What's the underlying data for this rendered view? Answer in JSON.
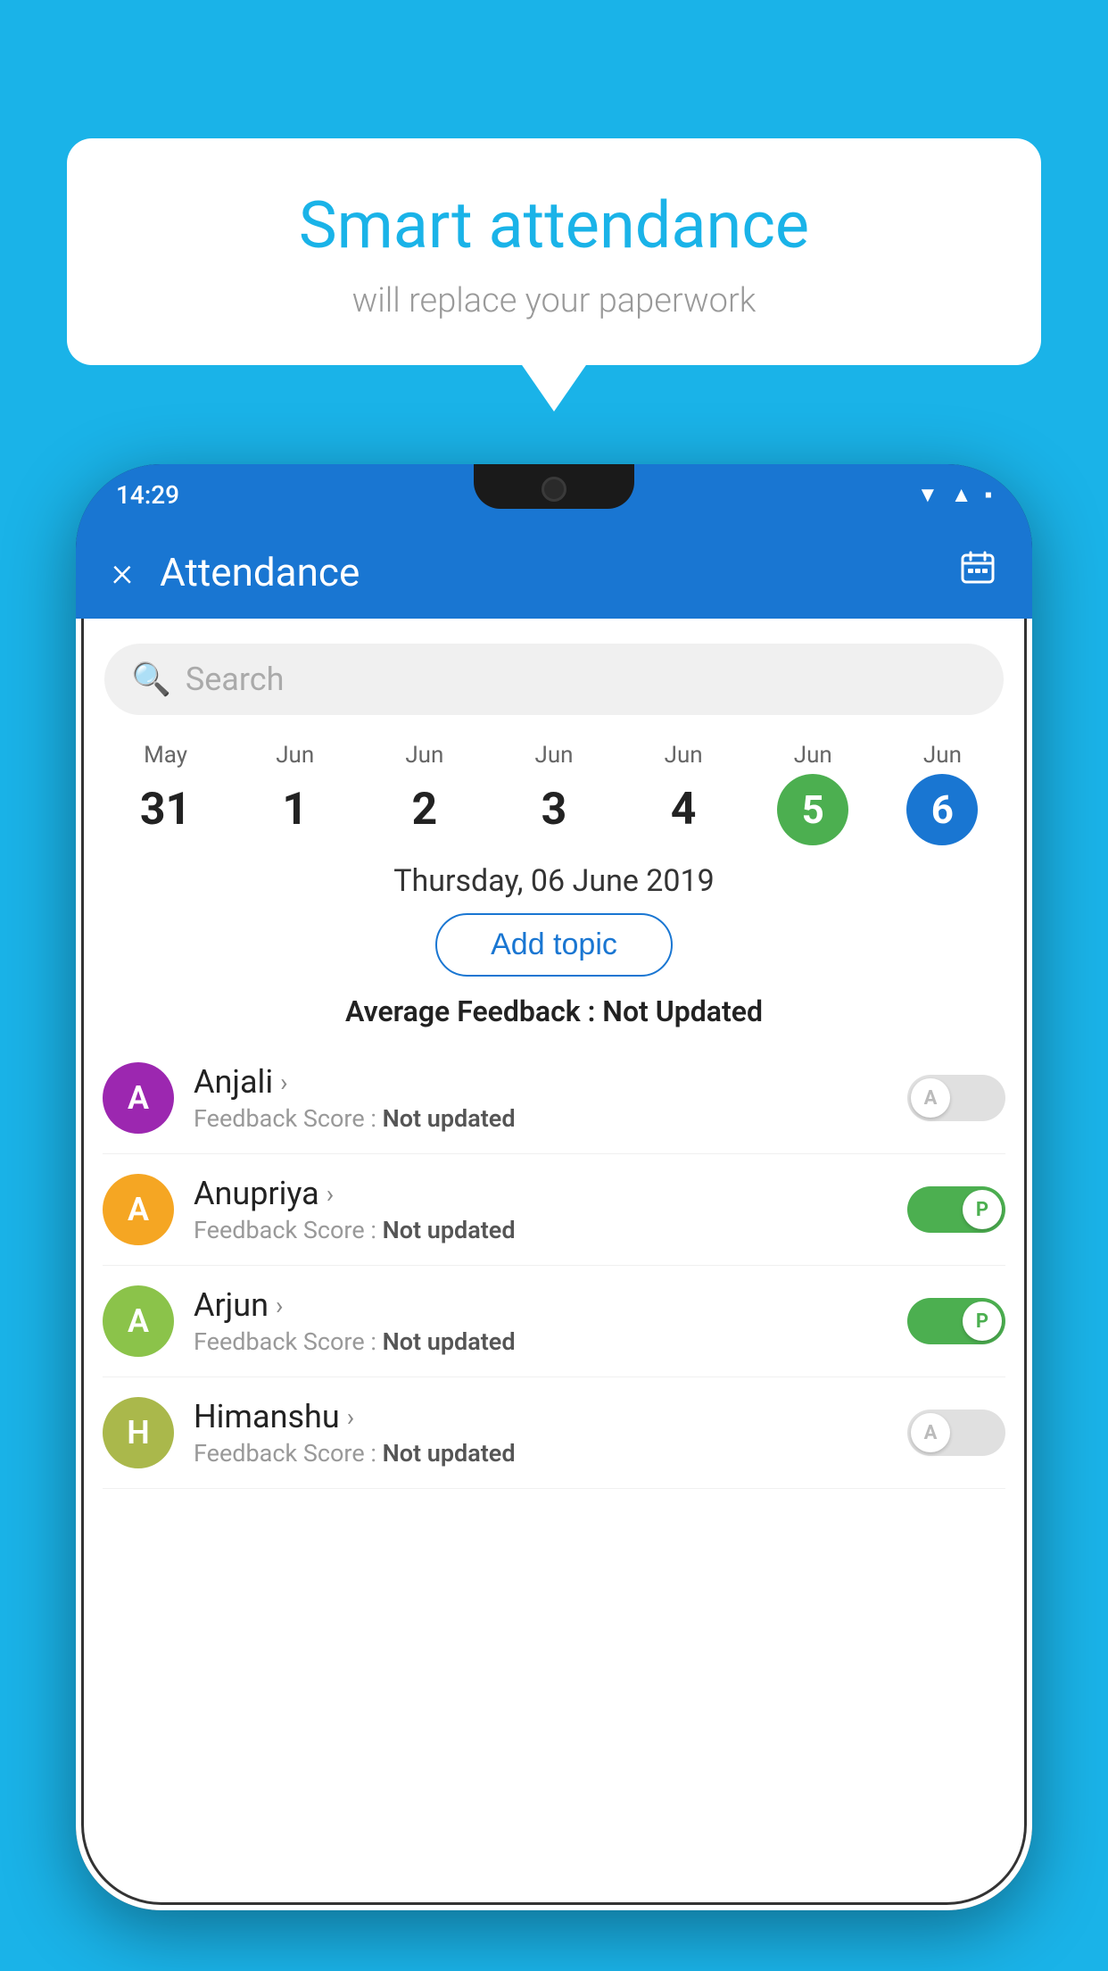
{
  "background_color": "#1ab3e8",
  "bubble": {
    "title": "Smart attendance",
    "subtitle": "will replace your paperwork"
  },
  "status_bar": {
    "time": "14:29",
    "icons": [
      "wifi",
      "signal",
      "battery"
    ]
  },
  "app_bar": {
    "title": "Attendance",
    "close_label": "×",
    "calendar_label": "📅"
  },
  "search": {
    "placeholder": "Search"
  },
  "calendar": {
    "days": [
      {
        "month": "May",
        "date": "31",
        "style": "normal"
      },
      {
        "month": "Jun",
        "date": "1",
        "style": "normal"
      },
      {
        "month": "Jun",
        "date": "2",
        "style": "normal"
      },
      {
        "month": "Jun",
        "date": "3",
        "style": "normal"
      },
      {
        "month": "Jun",
        "date": "4",
        "style": "normal"
      },
      {
        "month": "Jun",
        "date": "5",
        "style": "today"
      },
      {
        "month": "Jun",
        "date": "6",
        "style": "selected"
      }
    ]
  },
  "selected_date": "Thursday, 06 June 2019",
  "add_topic_label": "Add topic",
  "average_feedback": {
    "label": "Average Feedback :",
    "value": "Not Updated"
  },
  "students": [
    {
      "name": "Anjali",
      "avatar_letter": "A",
      "avatar_color": "#9c27b0",
      "feedback_label": "Feedback Score :",
      "feedback_value": "Not updated",
      "toggle": "off",
      "toggle_letter": "A"
    },
    {
      "name": "Anupriya",
      "avatar_letter": "A",
      "avatar_color": "#f5a623",
      "feedback_label": "Feedback Score :",
      "feedback_value": "Not updated",
      "toggle": "on",
      "toggle_letter": "P"
    },
    {
      "name": "Arjun",
      "avatar_letter": "A",
      "avatar_color": "#8bc34a",
      "feedback_label": "Feedback Score :",
      "feedback_value": "Not updated",
      "toggle": "on",
      "toggle_letter": "P"
    },
    {
      "name": "Himanshu",
      "avatar_letter": "H",
      "avatar_color": "#aab84b",
      "feedback_label": "Feedback Score :",
      "feedback_value": "Not updated",
      "toggle": "off",
      "toggle_letter": "A"
    }
  ]
}
